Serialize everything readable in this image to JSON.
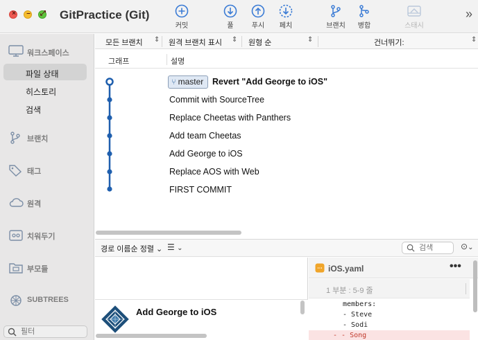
{
  "window": {
    "title": "GitPractice (Git)"
  },
  "toolbar": {
    "commit_label": "커밋",
    "pull_label": "풀",
    "push_label": "푸시",
    "fetch_label": "페치",
    "branch_label": "브랜치",
    "merge_label": "병합",
    "stash_label": "스태시",
    "more_label": "»"
  },
  "sidebar": {
    "workspace_label": "워크스페이스",
    "workspace_items": [
      {
        "label": "파일 상태"
      },
      {
        "label": "히스토리"
      },
      {
        "label": "검색"
      }
    ],
    "branches_label": "브랜치",
    "tags_label": "태그",
    "remotes_label": "원격",
    "stashes_label": "치워두기",
    "submodules_label": "부모들",
    "subtrees_label": "SUBTREES",
    "filter_placeholder": "필터"
  },
  "filterbar": {
    "all_branches": "모든 브랜치",
    "show_remote": "원격 브랜치 표시",
    "ancestor_order": "원형 순",
    "skip": "건너뛰기:"
  },
  "columns": {
    "graph": "그래프",
    "description": "설명"
  },
  "commits": [
    {
      "branch": "master",
      "message": "Revert \"Add George to iOS\""
    },
    {
      "message": "Commit with SourceTree"
    },
    {
      "message": "Replace Cheetas with Panthers"
    },
    {
      "message": "Add team Cheetas"
    },
    {
      "message": "Add George to iOS"
    },
    {
      "message": "Replace AOS with Web"
    },
    {
      "message": "FIRST COMMIT"
    }
  ],
  "bottom": {
    "sort_label": "경로 이름순 정렬",
    "search_placeholder": "검색",
    "selected_commit_title": "Add George to iOS"
  },
  "diff": {
    "filename": "iOS.yaml",
    "hunk_label": "1 부분 : 5-9 줄",
    "lines": [
      {
        "text": "members:",
        "type": "context"
      },
      {
        "text": "- Steve",
        "type": "context"
      },
      {
        "text": "- Sodi",
        "type": "context"
      },
      {
        "text": "- - Song",
        "type": "removed"
      }
    ]
  },
  "colors": {
    "accent": "#3a7bd5",
    "graph_line": "#1f5fae",
    "branch_tag_bg": "#dfe8f4",
    "removed_bg": "#fbe3e3"
  },
  "icons": {
    "commit": "plus-circle-icon",
    "pull": "arrow-down-circle-icon",
    "push": "arrow-up-circle-icon",
    "fetch": "dashed-arrow-down-circle-icon",
    "branch": "branch-icon",
    "merge": "merge-icon",
    "stash": "stash-icon"
  }
}
